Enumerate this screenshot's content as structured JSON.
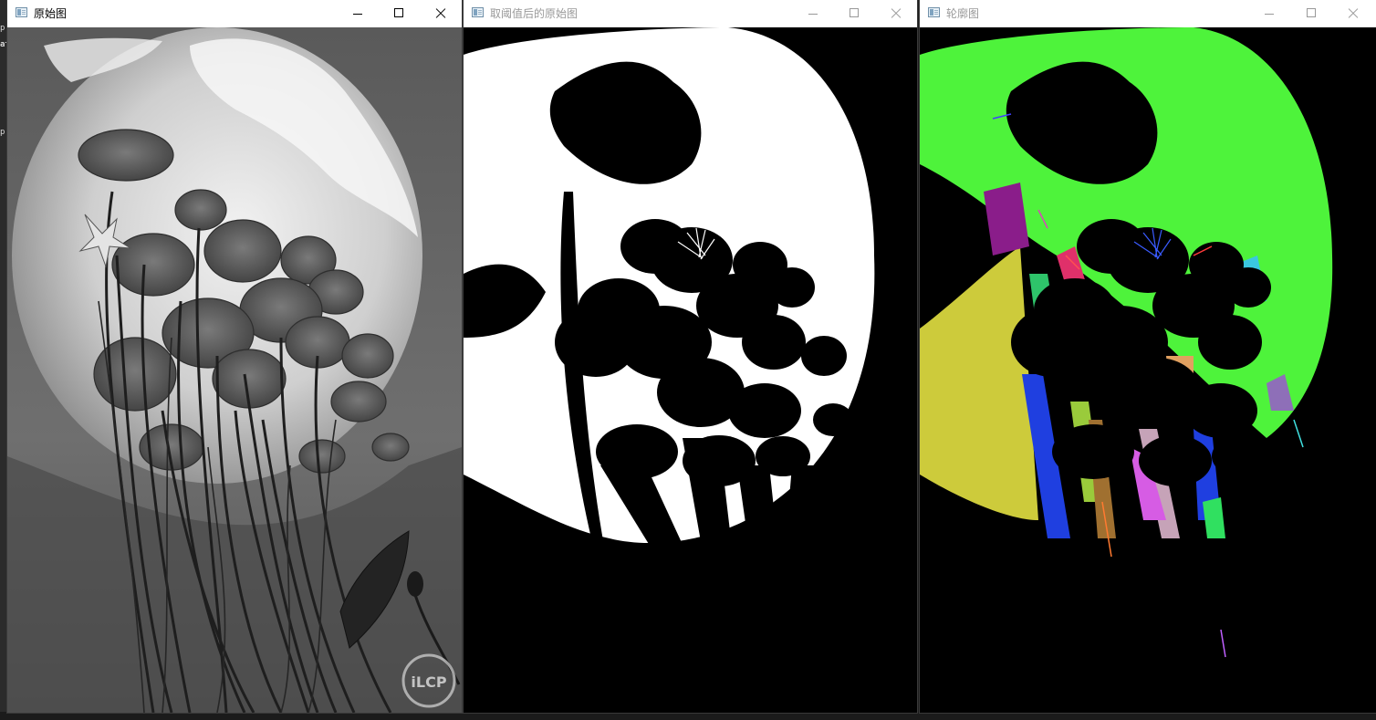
{
  "windows": [
    {
      "title": "原始图",
      "active": true
    },
    {
      "title": "取阈值后的原始图",
      "active": false
    },
    {
      "title": "轮廓图",
      "active": false
    }
  ],
  "background": {
    "chars": [
      "p",
      "at",
      "p"
    ]
  },
  "watermark": "iLCP"
}
